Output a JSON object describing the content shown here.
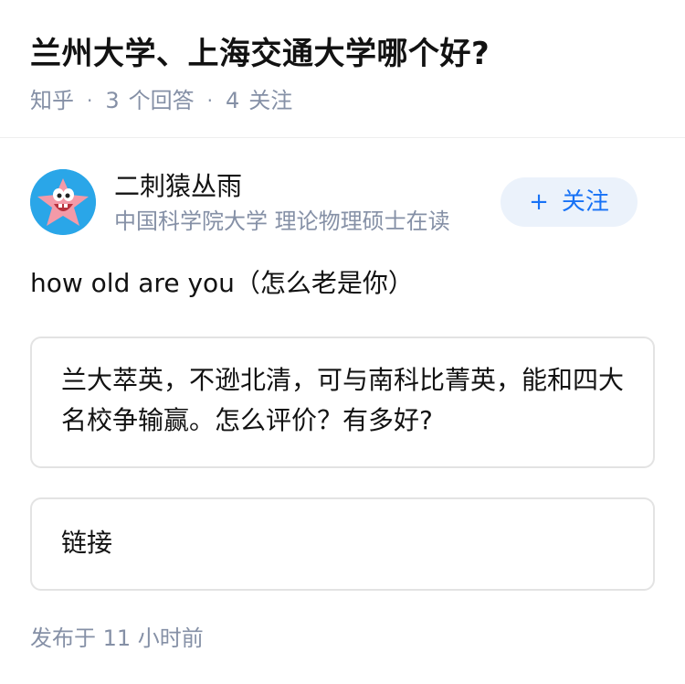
{
  "question": {
    "title": "兰州大学、上海交通大学哪个好?",
    "source": "知乎",
    "answers_count": "3",
    "answers_label": "个回答",
    "followers_count": "4",
    "followers_label": "关注"
  },
  "author": {
    "name": "二刺猿丛雨",
    "headline": "中国科学院大学 理论物理硕士在读",
    "avatar_icon": "cartoon-starfish-avatar-icon",
    "follow_icon": "+",
    "follow_label": "关注"
  },
  "answer": {
    "intro": "how old are you（怎么老是你）",
    "quote_text": "兰大萃英，不逊北清，可与南科比菁英，能和四大名校争输赢。怎么评价？有多好?",
    "link_label": "链接",
    "publish_time": "发布于 11 小时前"
  },
  "colors": {
    "accent": "#1772f6",
    "follow_bg": "#ebf2fb",
    "meta": "#8590a6",
    "text": "#121212",
    "border": "#e3e3e3"
  }
}
